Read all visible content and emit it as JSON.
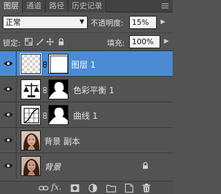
{
  "tabs": [
    {
      "label": "图层",
      "active": true
    },
    {
      "label": "通道",
      "active": false
    },
    {
      "label": "路径",
      "active": false
    },
    {
      "label": "历史记录",
      "active": false
    }
  ],
  "blend_mode": {
    "value": "正常"
  },
  "opacity": {
    "label": "不透明度:",
    "value": "15%"
  },
  "lock": {
    "label": "锁定:",
    "icons": [
      "lock-transparent-icon",
      "lock-paint-icon",
      "lock-move-icon",
      "lock-all-icon"
    ]
  },
  "fill": {
    "label": "填充:",
    "value": "100%"
  },
  "layers": [
    {
      "name": "图层 1",
      "selected": true,
      "visible": true,
      "thumb": "transparent",
      "mask": true
    },
    {
      "name": "色彩平衡 1",
      "selected": false,
      "visible": true,
      "thumb": "color-balance",
      "mask": true
    },
    {
      "name": "曲线 1",
      "selected": false,
      "visible": true,
      "thumb": "curves",
      "mask": true
    },
    {
      "name": "背景 副本",
      "selected": false,
      "visible": true,
      "thumb": "photo",
      "mask": false
    },
    {
      "name": "背景",
      "selected": false,
      "visible": true,
      "thumb": "photo",
      "mask": false,
      "locked": true
    }
  ],
  "bottom_toolbar": {
    "icons": [
      "link-layers-icon",
      "fx-icon",
      "add-mask-icon",
      "adjustment-layer-icon",
      "new-group-icon",
      "new-layer-icon",
      "delete-layer-icon"
    ],
    "fx_label": "fx."
  },
  "colors": {
    "selected_row": "#4a8bd3",
    "panel_bg": "#535353"
  }
}
